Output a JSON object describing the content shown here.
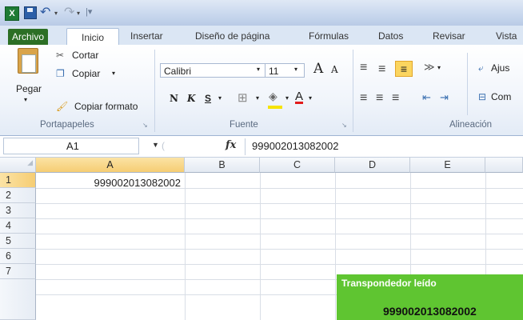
{
  "titlebar": {
    "app_icon": "excel-logo-icon",
    "app_letter": "X",
    "quick_access": [
      "save-icon",
      "undo-icon",
      "redo-icon"
    ]
  },
  "tabs": [
    "Archivo",
    "Inicio",
    "Insertar",
    "Diseño de página",
    "Fórmulas",
    "Datos",
    "Revisar",
    "Vista"
  ],
  "ribbon": {
    "clipboard": {
      "paste_label": "Pegar",
      "cut_label": "Cortar",
      "copy_label": "Copiar",
      "copy_format_label": "Copiar formato",
      "group_label": "Portapapeles"
    },
    "font": {
      "font_name": "Calibri",
      "font_size": "11",
      "bold": "N",
      "italic": "K",
      "underline": "S",
      "grow": "A",
      "shrink": "A",
      "font_color_letter": "A",
      "group_label": "Fuente"
    },
    "alignment": {
      "group_label": "Alineación",
      "wrap_label": "Ajus",
      "merge_label": "Com"
    }
  },
  "formula_bar": {
    "name_box": "A1",
    "fx": "fx",
    "value": "999002013082002"
  },
  "grid": {
    "columns": [
      "A",
      "B",
      "C",
      "D",
      "E"
    ],
    "rows": [
      "1",
      "2",
      "3",
      "4",
      "5",
      "6",
      "7"
    ],
    "cell_A1": "999002013082002"
  },
  "overlay": {
    "title": "Transpondedor leído",
    "value": "999002013082002",
    "color": "#5fc531"
  }
}
